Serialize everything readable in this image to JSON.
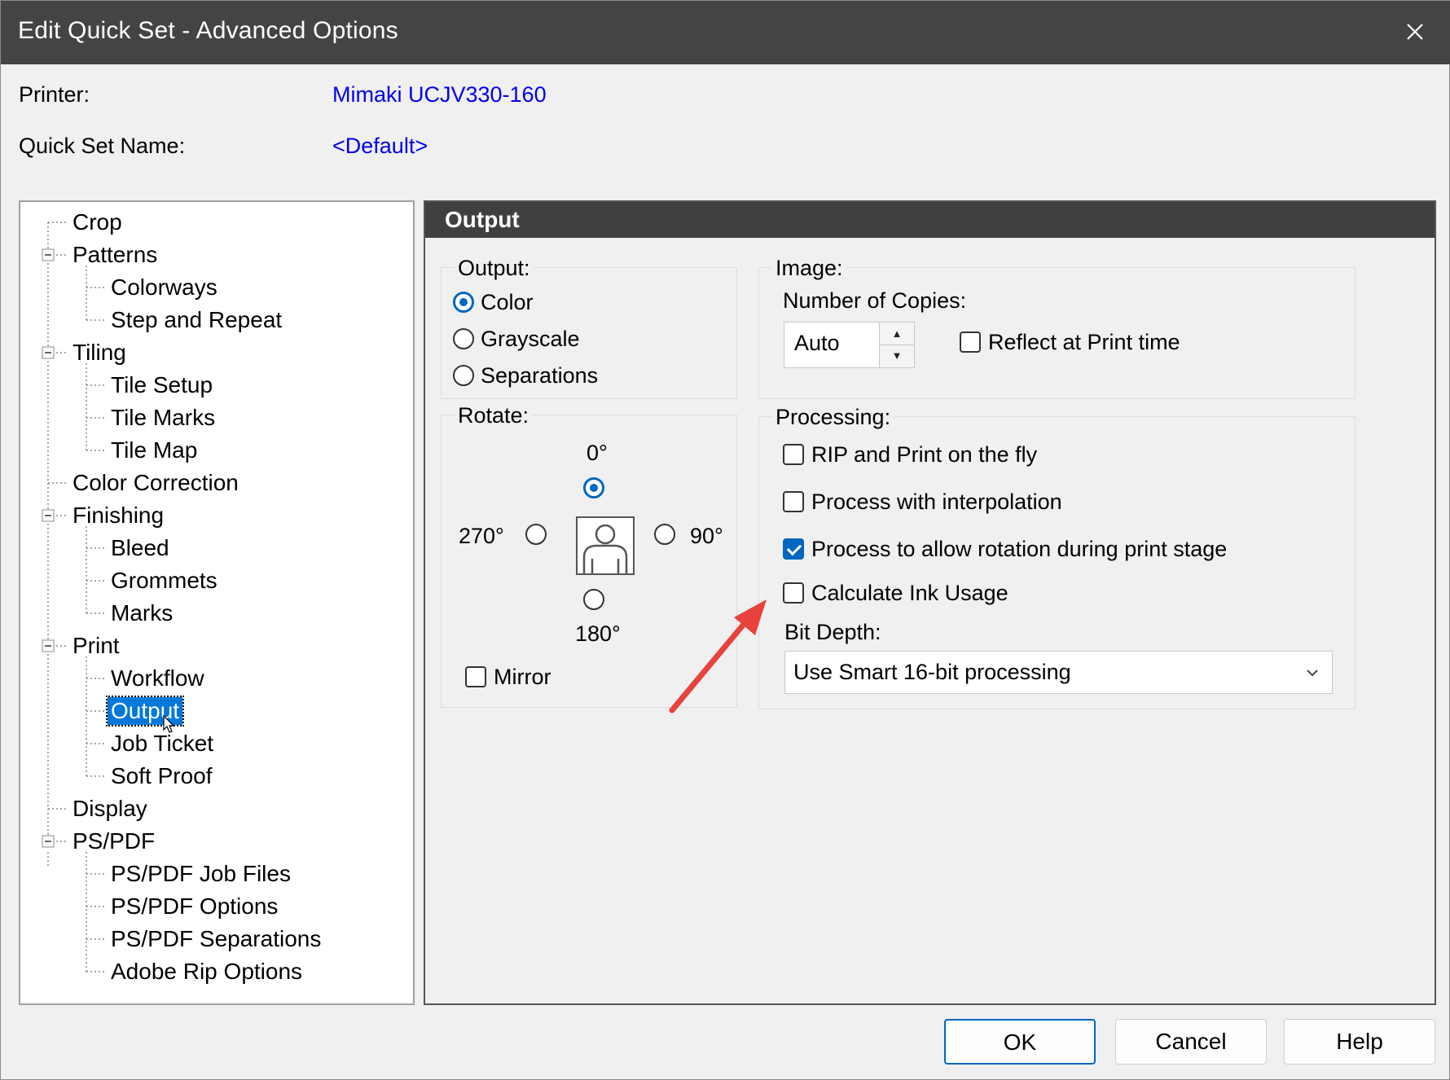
{
  "window": {
    "title": "Edit Quick Set - Advanced Options",
    "close_icon": "close-icon"
  },
  "printer": {
    "label": "Printer:",
    "value": "Mimaki UCJV330-160"
  },
  "quickset": {
    "label": "Quick Set Name:",
    "value": "<Default>"
  },
  "tree": {
    "items": [
      {
        "label": "Crop",
        "level": 0
      },
      {
        "label": "Patterns",
        "level": 0,
        "expandable": true
      },
      {
        "label": "Colorways",
        "level": 1
      },
      {
        "label": "Step and Repeat",
        "level": 1
      },
      {
        "label": "Tiling",
        "level": 0,
        "expandable": true
      },
      {
        "label": "Tile Setup",
        "level": 1
      },
      {
        "label": "Tile Marks",
        "level": 1
      },
      {
        "label": "Tile Map",
        "level": 1
      },
      {
        "label": "Color Correction",
        "level": 0
      },
      {
        "label": "Finishing",
        "level": 0,
        "expandable": true
      },
      {
        "label": "Bleed",
        "level": 1
      },
      {
        "label": "Grommets",
        "level": 1
      },
      {
        "label": "Marks",
        "level": 1
      },
      {
        "label": "Print",
        "level": 0,
        "expandable": true
      },
      {
        "label": "Workflow",
        "level": 1
      },
      {
        "label": "Output",
        "level": 1,
        "selected": true
      },
      {
        "label": "Job Ticket",
        "level": 1
      },
      {
        "label": "Soft Proof",
        "level": 1
      },
      {
        "label": "Display",
        "level": 0
      },
      {
        "label": "PS/PDF",
        "level": 0,
        "expandable": true
      },
      {
        "label": "PS/PDF Job Files",
        "level": 1
      },
      {
        "label": "PS/PDF Options",
        "level": 1
      },
      {
        "label": "PS/PDF Separations",
        "level": 1
      },
      {
        "label": "Adobe Rip Options",
        "level": 1
      }
    ]
  },
  "panel": {
    "header": "Output",
    "output": {
      "title": "Output:",
      "options": [
        "Color",
        "Grayscale",
        "Separations"
      ],
      "selected": "Color"
    },
    "image": {
      "title": "Image:",
      "copies_label": "Number of Copies:",
      "copies_value": "Auto",
      "reflect_label": "Reflect at Print time",
      "reflect_checked": false
    },
    "rotate": {
      "title": "Rotate:",
      "deg0": "0°",
      "deg90": "90°",
      "deg180": "180°",
      "deg270": "270°",
      "selected": "0°",
      "mirror_label": "Mirror",
      "mirror_checked": false
    },
    "processing": {
      "title": "Processing:",
      "rip_label": "RIP and Print on the fly",
      "interp_label": "Process with interpolation",
      "rotation_label": "Process to allow rotation during print stage",
      "ink_label": "Calculate Ink Usage",
      "bitdepth_label": "Bit Depth:",
      "bitdepth_value": "Use Smart 16-bit processing"
    }
  },
  "buttons": {
    "ok": "OK",
    "cancel": "Cancel",
    "help": "Help"
  },
  "colors": {
    "titlebar": "#444444",
    "link": "#0000ee",
    "accent": "#0067c0",
    "selection": "#0078d7",
    "annotation_arrow": "#e8423c"
  }
}
